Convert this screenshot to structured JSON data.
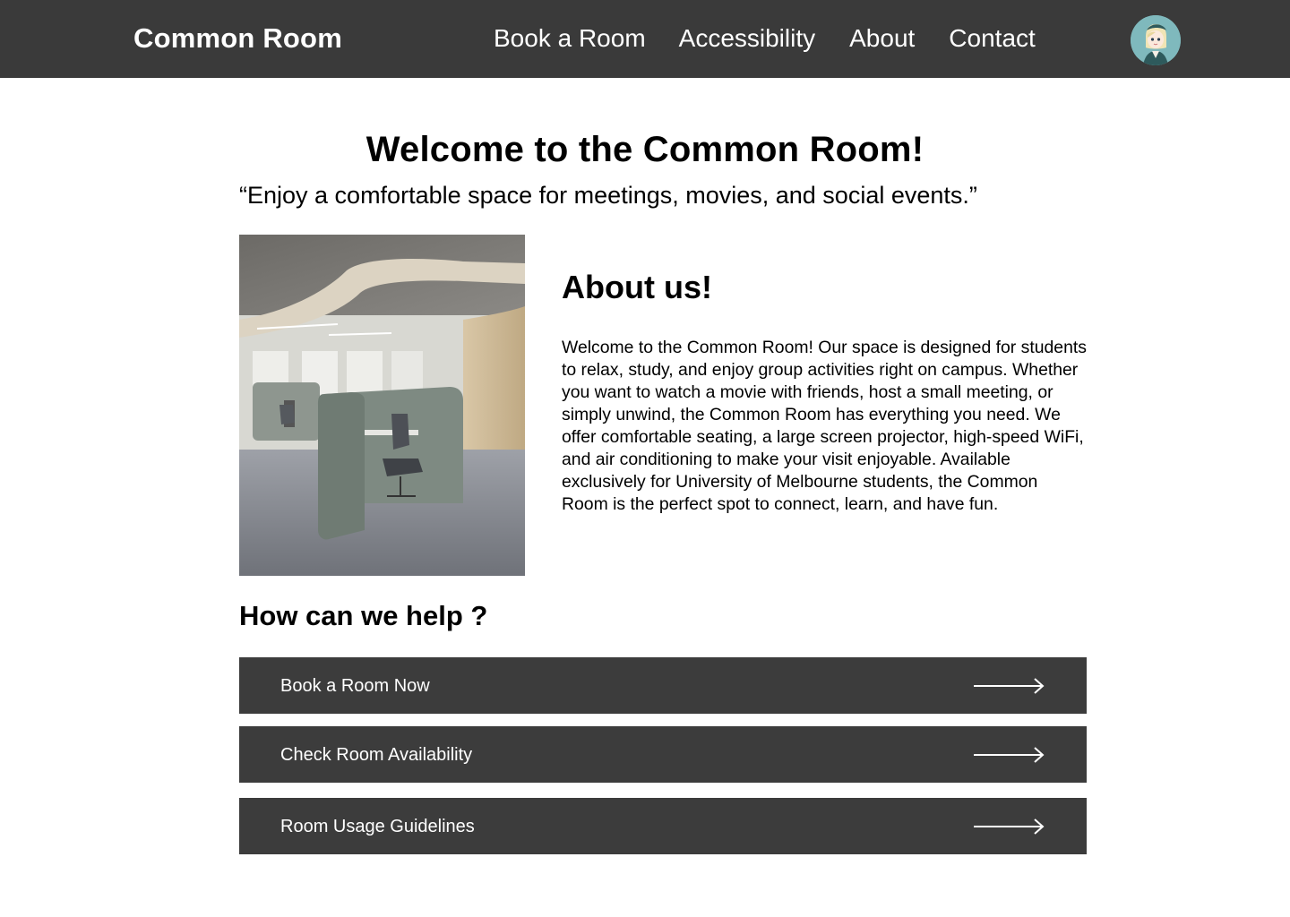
{
  "nav": {
    "brand": "Common Room",
    "links": [
      "Book a Room",
      "Accessibility",
      "About",
      "Contact"
    ]
  },
  "hero": {
    "title": "Welcome to the Common Room!",
    "quote": "“Enjoy a comfortable space for meetings, movies, and social events.”"
  },
  "about": {
    "title": "About us!",
    "body": "Welcome to the Common Room! Our space is designed for students to relax, study, and enjoy group activities right on campus. Whether you want to watch a movie with friends, host a small meeting, or simply unwind, the Common Room has everything you need. We offer comfortable seating, a large screen projector, high-speed WiFi, and air conditioning to make your visit enjoyable. Available exclusively for University of Melbourne students, the Common Room is the perfect spot to connect, learn, and have fun."
  },
  "help": {
    "title": "How can we help ?",
    "buttons": [
      "Book a Room Now",
      "Check Room Availability",
      "Room Usage Guidelines"
    ]
  },
  "icons": {
    "avatar": "user-avatar-icon",
    "arrow": "arrow-right-icon"
  },
  "colors": {
    "navbar_bg": "#3a3a3a",
    "button_bg": "#3c3c3c",
    "text_light": "#ffffff"
  }
}
